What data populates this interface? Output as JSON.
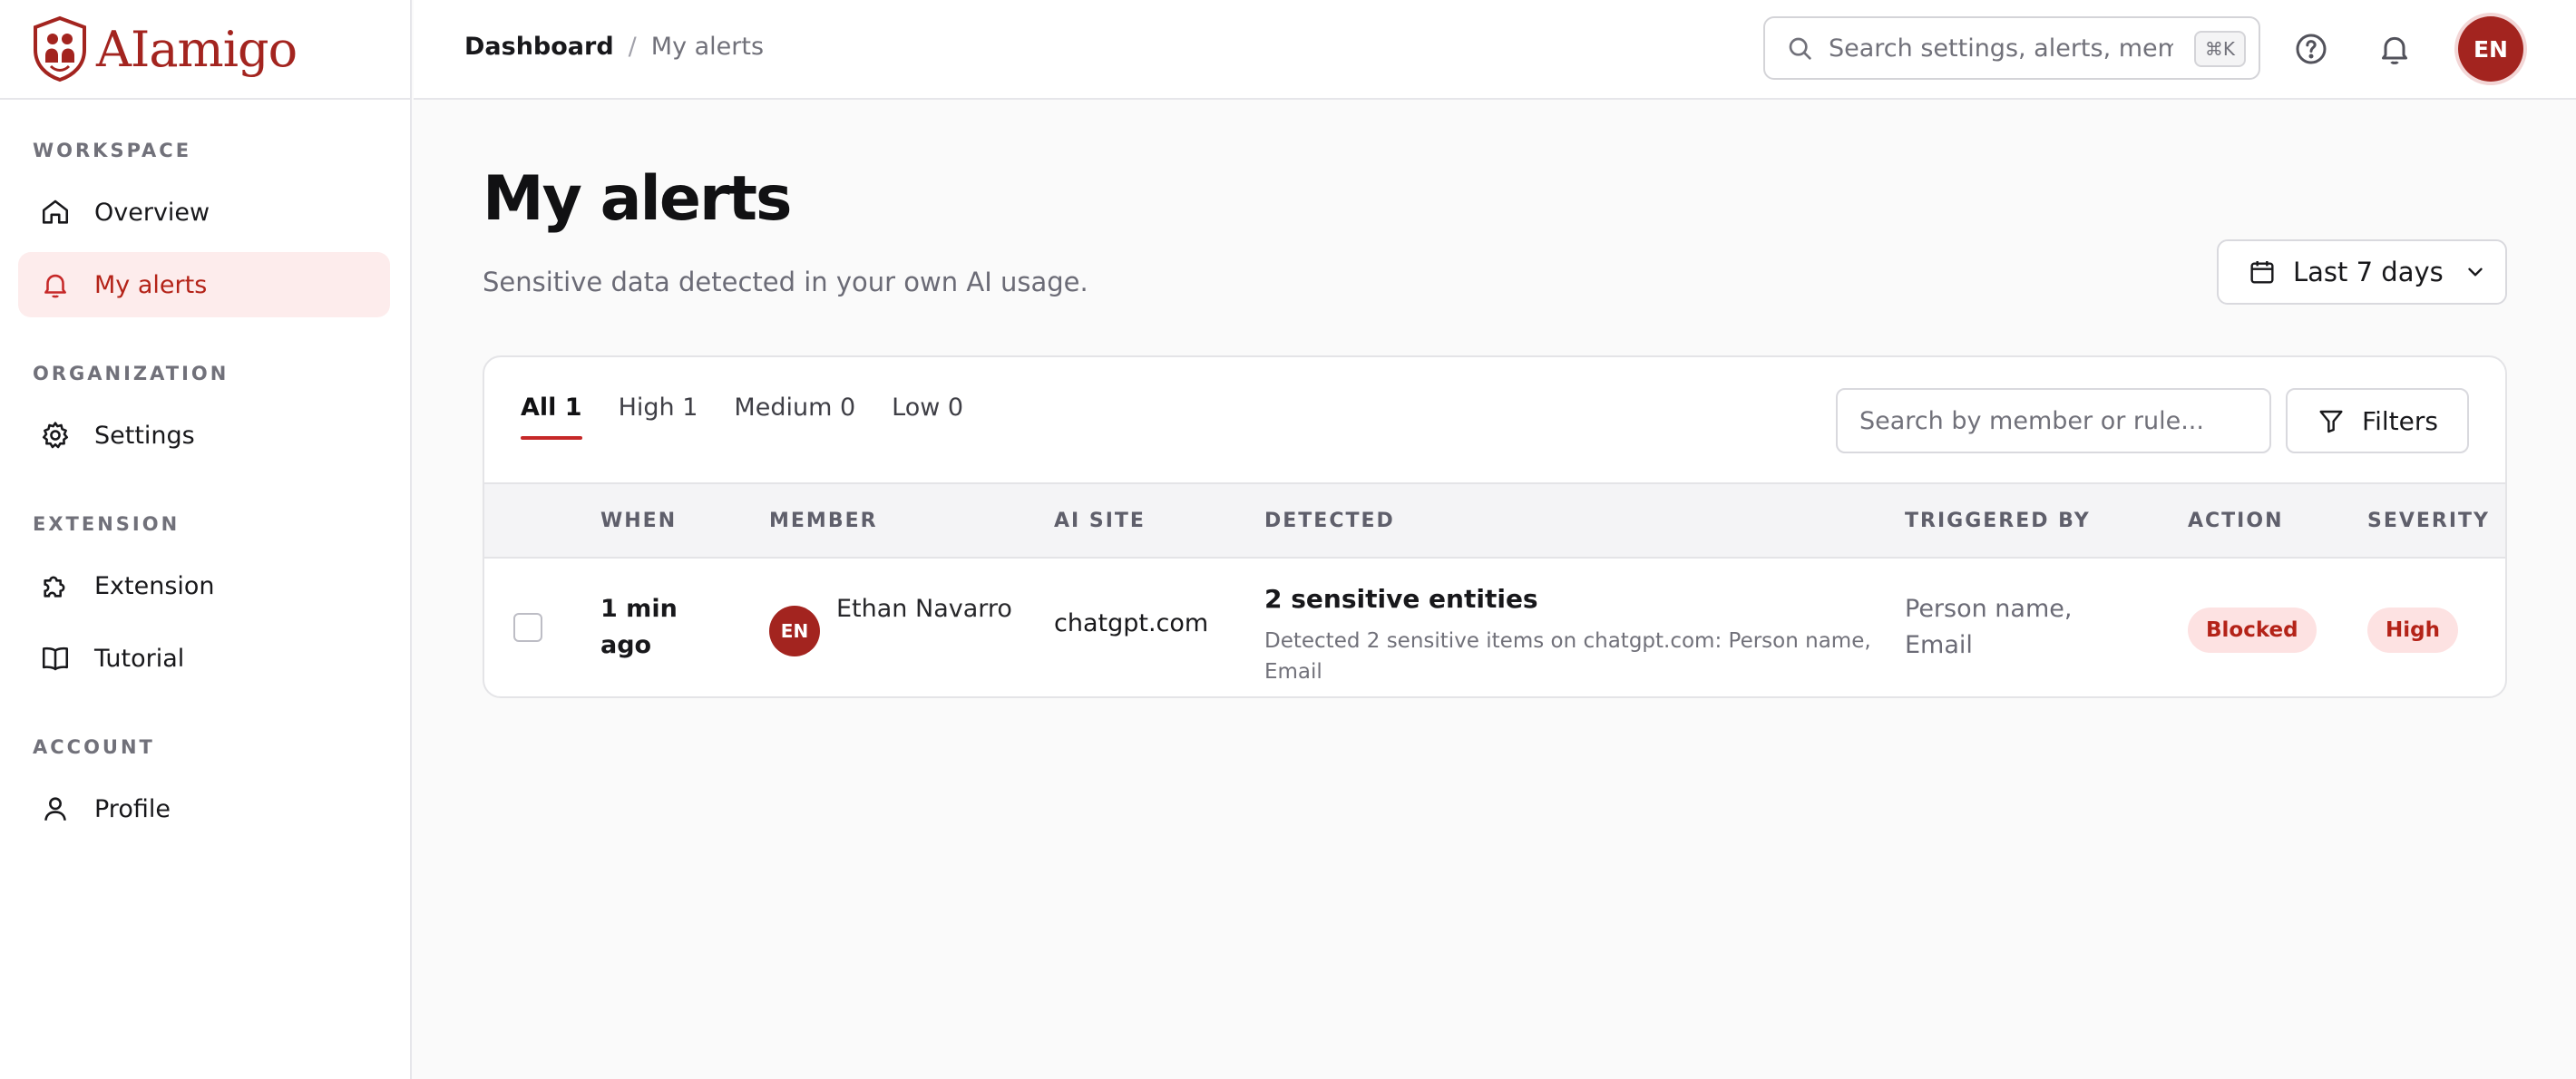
{
  "app": {
    "name": "AIamigo"
  },
  "sidebar": {
    "sections": [
      {
        "title": "WORKSPACE"
      },
      {
        "title": "ORGANIZATION"
      },
      {
        "title": "EXTENSION"
      },
      {
        "title": "ACCOUNT"
      }
    ],
    "items": [
      {
        "label": "Overview",
        "icon": "home-icon",
        "active": false
      },
      {
        "label": "My alerts",
        "icon": "bell-icon",
        "active": true
      },
      {
        "label": "Settings",
        "icon": "gear-icon",
        "active": false
      },
      {
        "label": "Extension",
        "icon": "puzzle-icon",
        "active": false
      },
      {
        "label": "Tutorial",
        "icon": "book-icon",
        "active": false
      },
      {
        "label": "Profile",
        "icon": "user-icon",
        "active": false
      }
    ]
  },
  "header": {
    "breadcrumb": {
      "home": "Dashboard",
      "separator": "/",
      "current": "My alerts"
    },
    "search": {
      "placeholder": "Search settings, alerts, members...",
      "shortcut": "⌘K"
    },
    "user_initials": "EN"
  },
  "page": {
    "title": "My alerts",
    "subtitle": "Sensitive data detected in your own AI usage.",
    "date_range": "Last 7 days"
  },
  "alerts": {
    "tabs": [
      {
        "label": "All 1",
        "active": true
      },
      {
        "label": "High 1",
        "active": false
      },
      {
        "label": "Medium 0",
        "active": false
      },
      {
        "label": "Low 0",
        "active": false
      }
    ],
    "search_placeholder": "Search by member or rule...",
    "filters_label": "Filters",
    "columns": [
      "WHEN",
      "MEMBER",
      "AI SITE",
      "DETECTED",
      "TRIGGERED BY",
      "ACTION",
      "SEVERITY"
    ],
    "rows": [
      {
        "when": "1 min ago",
        "member_initials": "EN",
        "member": "Ethan Navarro",
        "site": "chatgpt.com",
        "detected_title": "2 sensitive entities",
        "detected_desc": "Detected 2 sensitive items on chatgpt.com: Person name, Email",
        "triggered_by": "Person name, Email",
        "action": "Blocked",
        "severity": "High"
      }
    ]
  },
  "colors": {
    "accent": "#a3241f",
    "badge_bg": "#fde2e2",
    "badge_text": "#b42318"
  }
}
